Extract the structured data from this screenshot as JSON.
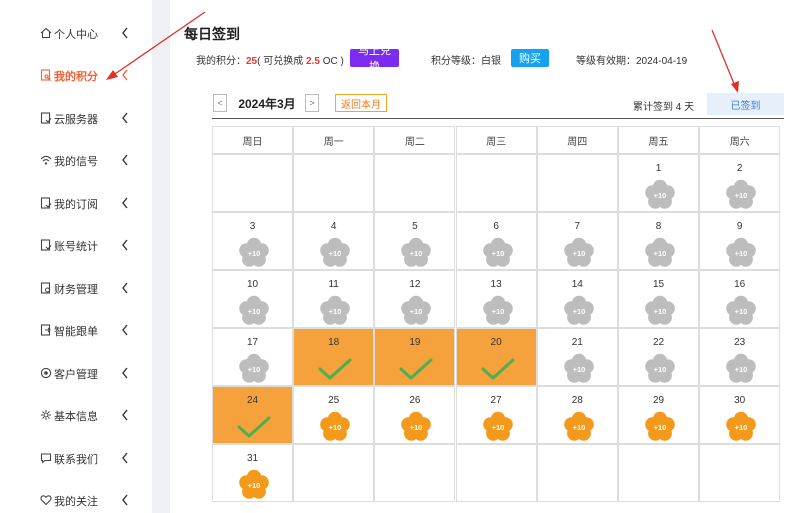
{
  "sidebar": {
    "items": [
      {
        "label": "个人中心",
        "icon": "home-icon"
      },
      {
        "label": "我的积分",
        "icon": "points-doc-icon",
        "active": true
      },
      {
        "label": "云服务器",
        "icon": "cloud-server-icon"
      },
      {
        "label": "我的信号",
        "icon": "wifi-icon"
      },
      {
        "label": "我的订阅",
        "icon": "subscription-icon"
      },
      {
        "label": "账号统计",
        "icon": "stats-icon"
      },
      {
        "label": "财务管理",
        "icon": "finance-icon"
      },
      {
        "label": "智能跟单",
        "icon": "smart-follow-icon"
      },
      {
        "label": "客户管理",
        "icon": "customer-icon"
      },
      {
        "label": "基本信息",
        "icon": "settings-icon"
      },
      {
        "label": "联系我们",
        "icon": "contact-icon"
      },
      {
        "label": "我的关注",
        "icon": "heart-icon"
      }
    ]
  },
  "page": {
    "title": "每日签到",
    "points_label": "我的积分：",
    "points_value": "25",
    "exchange_prefix": "( 可兑换成 ",
    "exchange_value": "2.5",
    "exchange_suffix": " OC )",
    "exchange_button": "马上兑换",
    "level_label": "积分等级：",
    "level_value": "白银",
    "buy_button": "购买",
    "expiry_label": "等级有效期：",
    "expiry_value": "2024-04-19"
  },
  "calendar": {
    "prev": "<",
    "next": ">",
    "month": "2024年3月",
    "back_button": "返回本月",
    "total_text": "累计签到 4 天",
    "signed_button": "已签到",
    "weekdays": [
      "周日",
      "周一",
      "周二",
      "周三",
      "周四",
      "周五",
      "周六"
    ],
    "first_weekday": 5,
    "days_in_month": 31,
    "reward_label": "+10",
    "checked_days": [
      18,
      19,
      20,
      24
    ],
    "past_through_day": 24
  },
  "colors": {
    "accent": "#f5603a",
    "purple": "#7b2bf2",
    "blue": "#16a2f0",
    "checked_bg": "#f6a23c",
    "check_mark": "#4caf50",
    "flower_gray": "#bdbdbd",
    "flower_orange": "#f39a1c"
  }
}
